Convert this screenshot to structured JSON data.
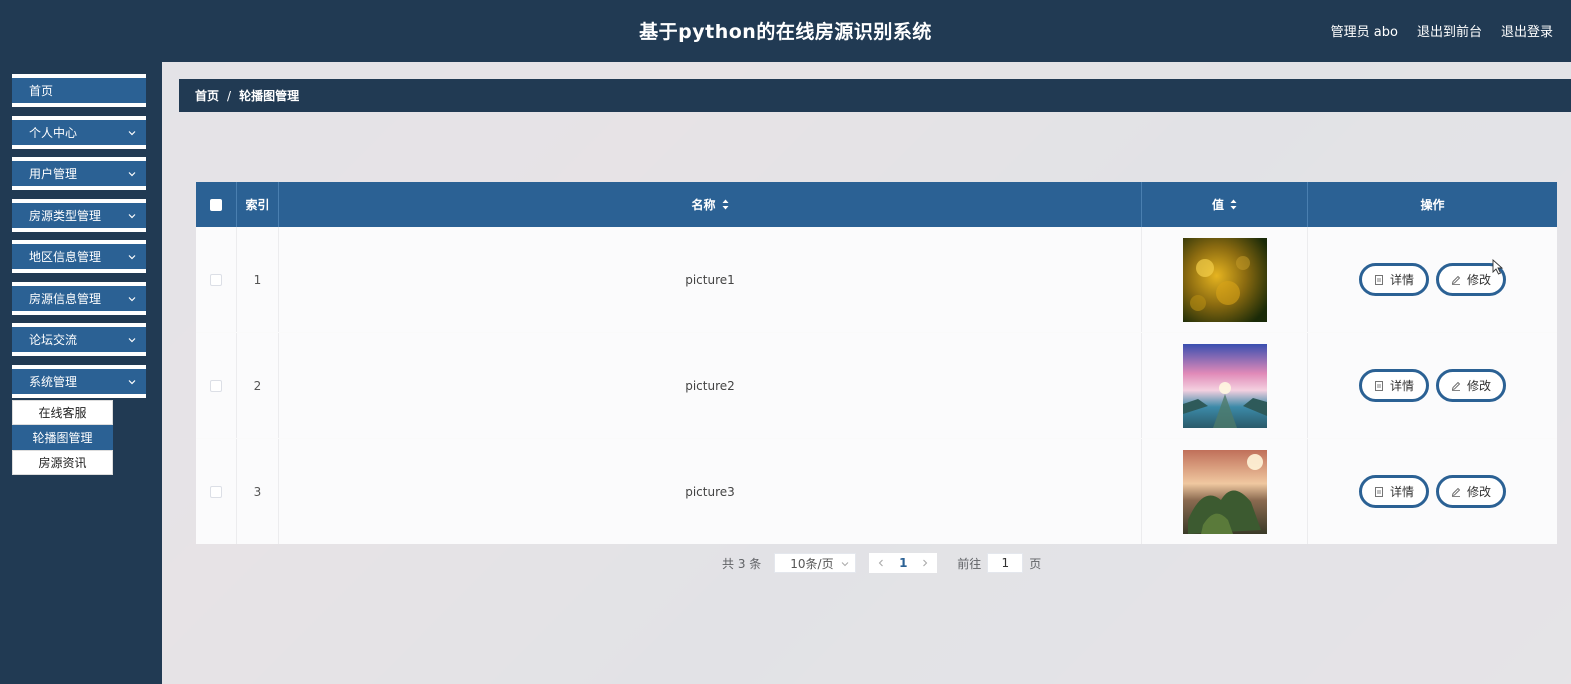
{
  "header": {
    "title": "基于python的在线房源识别系统",
    "user_label": "管理员 abo",
    "to_front": "退出到前台",
    "logout": "退出登录"
  },
  "sidebar": {
    "items": [
      {
        "label": "首页",
        "has_arrow": false
      },
      {
        "label": "个人中心",
        "has_arrow": true
      },
      {
        "label": "用户管理",
        "has_arrow": true
      },
      {
        "label": "房源类型管理",
        "has_arrow": true
      },
      {
        "label": "地区信息管理",
        "has_arrow": true
      },
      {
        "label": "房源信息管理",
        "has_arrow": true
      },
      {
        "label": "论坛交流",
        "has_arrow": true
      },
      {
        "label": "系统管理",
        "has_arrow": true
      }
    ],
    "submenu": [
      {
        "label": "在线客服",
        "active": false
      },
      {
        "label": "轮播图管理",
        "active": true
      },
      {
        "label": "房源资讯",
        "active": false
      }
    ]
  },
  "breadcrumb": {
    "home": "首页",
    "separator": "/",
    "current": "轮播图管理"
  },
  "table": {
    "columns": {
      "index": "索引",
      "name": "名称",
      "value": "值",
      "actions": "操作"
    },
    "rows": [
      {
        "index": "1",
        "name": "picture1",
        "thumb": "golden-bokeh"
      },
      {
        "index": "2",
        "name": "picture2",
        "thumb": "pink-sky-landscape"
      },
      {
        "index": "3",
        "name": "picture3",
        "thumb": "sunset-trees"
      }
    ],
    "detail_label": "详情",
    "edit_label": "修改"
  },
  "pagination": {
    "total": "共 3 条",
    "page_size": "10条/页",
    "current_page": "1",
    "goto_label": "前往",
    "goto_value": "1",
    "page_suffix": "页"
  },
  "colors": {
    "header_bg": "#213a53",
    "accent": "#2b6194"
  }
}
